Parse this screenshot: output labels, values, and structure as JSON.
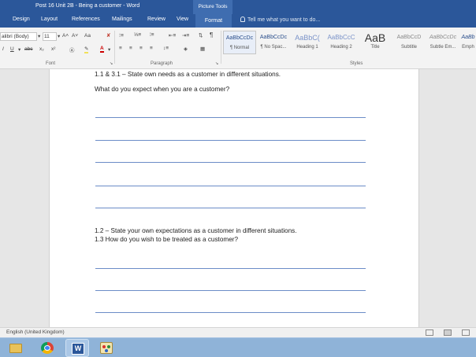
{
  "window": {
    "title": "Post 16 Unit 2B - Being a customer - Word",
    "contextual_group": "Picture Tools"
  },
  "tabs": [
    "Design",
    "Layout",
    "References",
    "Mailings",
    "Review",
    "View",
    "Format"
  ],
  "tell_me": "Tell me what you want to do...",
  "ribbon": {
    "font_name": "alibri (Body)",
    "font_size": "11",
    "grow_font": "A˄",
    "shrink_font": "A˅",
    "change_case": "Aa",
    "clear_format": "✘",
    "bold": "I",
    "underline": "U",
    "strike": "abc",
    "subscript": "x₂",
    "superscript": "x²",
    "font_color": "A",
    "pilcrow": "¶",
    "group_font": "Font",
    "group_paragraph": "Paragraph",
    "group_styles": "Styles",
    "styles": [
      {
        "preview": "AaBbCcDc",
        "name": "¶ Normal"
      },
      {
        "preview": "AaBbCcDc",
        "name": "¶ No Spac..."
      },
      {
        "preview": "AaBbC(",
        "name": "Heading 1"
      },
      {
        "preview": "AaBbCcC",
        "name": "Heading 2"
      },
      {
        "preview": "AaB",
        "name": "Title"
      },
      {
        "preview": "AaBbCcD",
        "name": "Subtitle"
      },
      {
        "preview": "AaBbCcDc",
        "name": "Subtle Em..."
      },
      {
        "preview": "AaBb",
        "name": "Emph"
      }
    ]
  },
  "document": {
    "line1": "1.1 & 3.1 – State own needs as a customer in different situations.",
    "line2": "What do you expect when you are a customer?",
    "line3": "1.2 – State your own expectations as a customer in different situations.",
    "line4": "1.3 How do you wish to be treated as a customer?"
  },
  "status": {
    "language": "English (United Kingdom)"
  },
  "taskbar": {
    "apps": [
      "file-explorer",
      "chrome",
      "word",
      "paint"
    ]
  },
  "colors": {
    "word_blue": "#2b579a",
    "rule_blue": "#6b8cc7",
    "taskbar": "#8fb3d8"
  }
}
